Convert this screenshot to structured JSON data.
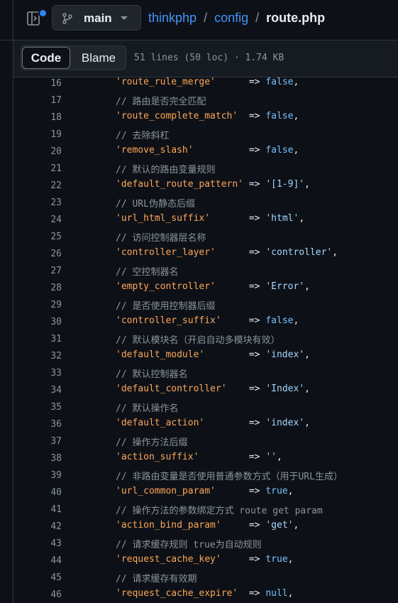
{
  "header": {
    "branch": "main",
    "breadcrumb": {
      "repo": "thinkphp",
      "sep1": "/",
      "dir": "config",
      "sep2": "/",
      "file": "route.php"
    }
  },
  "toolbar": {
    "tabs": [
      "Code",
      "Blame"
    ],
    "file_info": "51 lines (50 loc) · 1.74 KB"
  },
  "colors": {
    "background": "#0d1117",
    "link": "#4493f8",
    "string": "#a5d6ff",
    "key_string": "#ffa657",
    "keyword": "#79c0ff",
    "comment": "#8b949e",
    "badge": "#2f81f7"
  },
  "code": {
    "lines": [
      {
        "n": "16",
        "tokens": [
          [
            "s",
            "'route_rule_merge'"
          ],
          [
            "o",
            "      => "
          ],
          [
            "k",
            "false"
          ],
          [
            "o",
            ","
          ]
        ]
      },
      {
        "n": "17",
        "tokens": [
          [
            "c",
            "// 路由是否完全匹配"
          ]
        ]
      },
      {
        "n": "18",
        "tokens": [
          [
            "s",
            "'route_complete_match'"
          ],
          [
            "o",
            "  => "
          ],
          [
            "k",
            "false"
          ],
          [
            "o",
            ","
          ]
        ]
      },
      {
        "n": "19",
        "tokens": [
          [
            "c",
            "// 去除斜杠"
          ]
        ]
      },
      {
        "n": "20",
        "tokens": [
          [
            "s",
            "'remove_slash'"
          ],
          [
            "o",
            "          => "
          ],
          [
            "k",
            "false"
          ],
          [
            "o",
            ","
          ]
        ]
      },
      {
        "n": "21",
        "tokens": [
          [
            "c",
            "// 默认的路由变量规则"
          ]
        ]
      },
      {
        "n": "22",
        "tokens": [
          [
            "s",
            "'default_route_pattern'"
          ],
          [
            "o",
            " => "
          ],
          [
            "v",
            "'[1-9]'"
          ],
          [
            "o",
            ","
          ]
        ]
      },
      {
        "n": "23",
        "tokens": [
          [
            "c",
            "// URL伪静态后缀"
          ]
        ]
      },
      {
        "n": "24",
        "tokens": [
          [
            "s",
            "'url_html_suffix'"
          ],
          [
            "o",
            "       => "
          ],
          [
            "v",
            "'html'"
          ],
          [
            "o",
            ","
          ]
        ]
      },
      {
        "n": "25",
        "tokens": [
          [
            "c",
            "// 访问控制器层名称"
          ]
        ]
      },
      {
        "n": "26",
        "tokens": [
          [
            "s",
            "'controller_layer'"
          ],
          [
            "o",
            "      => "
          ],
          [
            "v",
            "'controller'"
          ],
          [
            "o",
            ","
          ]
        ]
      },
      {
        "n": "27",
        "tokens": [
          [
            "c",
            "// 空控制器名"
          ]
        ]
      },
      {
        "n": "28",
        "tokens": [
          [
            "s",
            "'empty_controller'"
          ],
          [
            "o",
            "      => "
          ],
          [
            "v",
            "'Error'"
          ],
          [
            "o",
            ","
          ]
        ]
      },
      {
        "n": "29",
        "tokens": [
          [
            "c",
            "// 是否使用控制器后缀"
          ]
        ]
      },
      {
        "n": "30",
        "tokens": [
          [
            "s",
            "'controller_suffix'"
          ],
          [
            "o",
            "     => "
          ],
          [
            "k",
            "false"
          ],
          [
            "o",
            ","
          ]
        ]
      },
      {
        "n": "31",
        "tokens": [
          [
            "c",
            "// 默认模块名（开启自动多模块有效）"
          ]
        ]
      },
      {
        "n": "32",
        "tokens": [
          [
            "s",
            "'default_module'"
          ],
          [
            "o",
            "        => "
          ],
          [
            "v",
            "'index'"
          ],
          [
            "o",
            ","
          ]
        ]
      },
      {
        "n": "33",
        "tokens": [
          [
            "c",
            "// 默认控制器名"
          ]
        ]
      },
      {
        "n": "34",
        "tokens": [
          [
            "s",
            "'default_controller'"
          ],
          [
            "o",
            "    => "
          ],
          [
            "v",
            "'Index'"
          ],
          [
            "o",
            ","
          ]
        ]
      },
      {
        "n": "35",
        "tokens": [
          [
            "c",
            "// 默认操作名"
          ]
        ]
      },
      {
        "n": "36",
        "tokens": [
          [
            "s",
            "'default_action'"
          ],
          [
            "o",
            "        => "
          ],
          [
            "v",
            "'index'"
          ],
          [
            "o",
            ","
          ]
        ]
      },
      {
        "n": "37",
        "tokens": [
          [
            "c",
            "// 操作方法后缀"
          ]
        ]
      },
      {
        "n": "38",
        "tokens": [
          [
            "s",
            "'action_suffix'"
          ],
          [
            "o",
            "         => "
          ],
          [
            "v",
            "''"
          ],
          [
            "o",
            ","
          ]
        ]
      },
      {
        "n": "39",
        "tokens": [
          [
            "c",
            "// 非路由变量是否使用普通参数方式（用于URL生成）"
          ]
        ]
      },
      {
        "n": "40",
        "tokens": [
          [
            "s",
            "'url_common_param'"
          ],
          [
            "o",
            "      => "
          ],
          [
            "k",
            "true"
          ],
          [
            "o",
            ","
          ]
        ]
      },
      {
        "n": "41",
        "tokens": [
          [
            "c",
            "// 操作方法的参数绑定方式 route get param"
          ]
        ]
      },
      {
        "n": "42",
        "tokens": [
          [
            "s",
            "'action_bind_param'"
          ],
          [
            "o",
            "     => "
          ],
          [
            "v",
            "'get'"
          ],
          [
            "o",
            ","
          ]
        ]
      },
      {
        "n": "43",
        "tokens": [
          [
            "c",
            "// 请求缓存规则 true为自动规则"
          ]
        ]
      },
      {
        "n": "44",
        "tokens": [
          [
            "s",
            "'request_cache_key'"
          ],
          [
            "o",
            "     => "
          ],
          [
            "k",
            "true"
          ],
          [
            "o",
            ","
          ]
        ]
      },
      {
        "n": "45",
        "tokens": [
          [
            "c",
            "// 请求缓存有效期"
          ]
        ]
      },
      {
        "n": "46",
        "tokens": [
          [
            "s",
            "'request_cache_expire'"
          ],
          [
            "o",
            "  => "
          ],
          [
            "k",
            "null"
          ],
          [
            "o",
            ","
          ]
        ]
      }
    ]
  }
}
